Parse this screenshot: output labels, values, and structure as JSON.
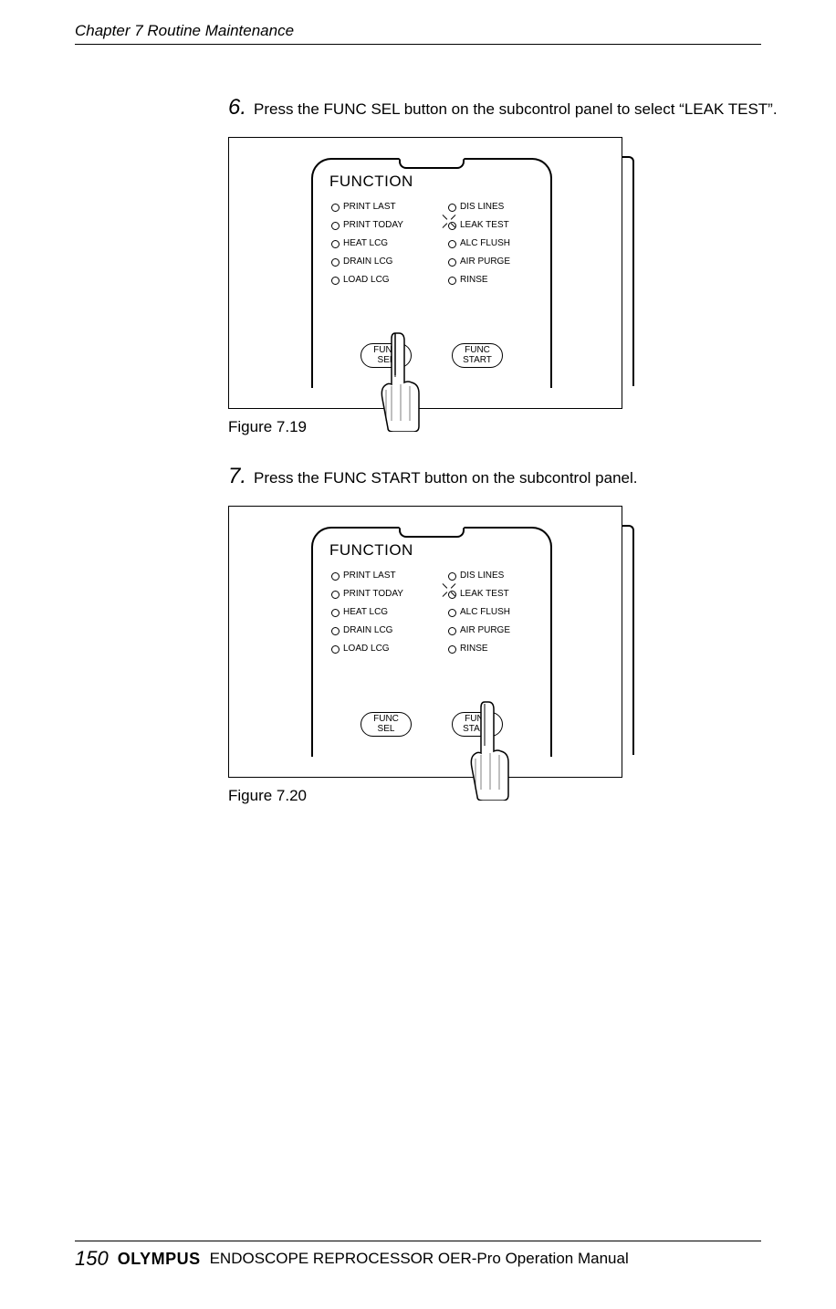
{
  "header": {
    "chapter": "Chapter 7  Routine Maintenance"
  },
  "steps": [
    {
      "num": "6.",
      "text": "Press the FUNC SEL button on the subcontrol panel to select “LEAK TEST”."
    },
    {
      "num": "7.",
      "text": "Press the FUNC START button on the subcontrol panel."
    }
  ],
  "panel": {
    "title": "FUNCTION",
    "left_items": [
      "PRINT LAST",
      "PRINT TODAY",
      "HEAT LCG",
      "DRAIN LCG",
      "LOAD LCG"
    ],
    "right_items": [
      "DIS LINES",
      "LEAK TEST",
      "ALC FLUSH",
      "AIR PURGE",
      "RINSE"
    ],
    "selected": "LEAK TEST",
    "btn_sel": {
      "l1": "FUNC",
      "l2": "SEL"
    },
    "btn_start": {
      "l1": "FUNC",
      "l2": "START"
    }
  },
  "captions": {
    "fig1": "Figure 7.19",
    "fig2": "Figure 7.20"
  },
  "footer": {
    "page": "150",
    "brand": "OLYMPUS",
    "title": "ENDOSCOPE REPROCESSOR OER-Pro Operation Manual"
  }
}
